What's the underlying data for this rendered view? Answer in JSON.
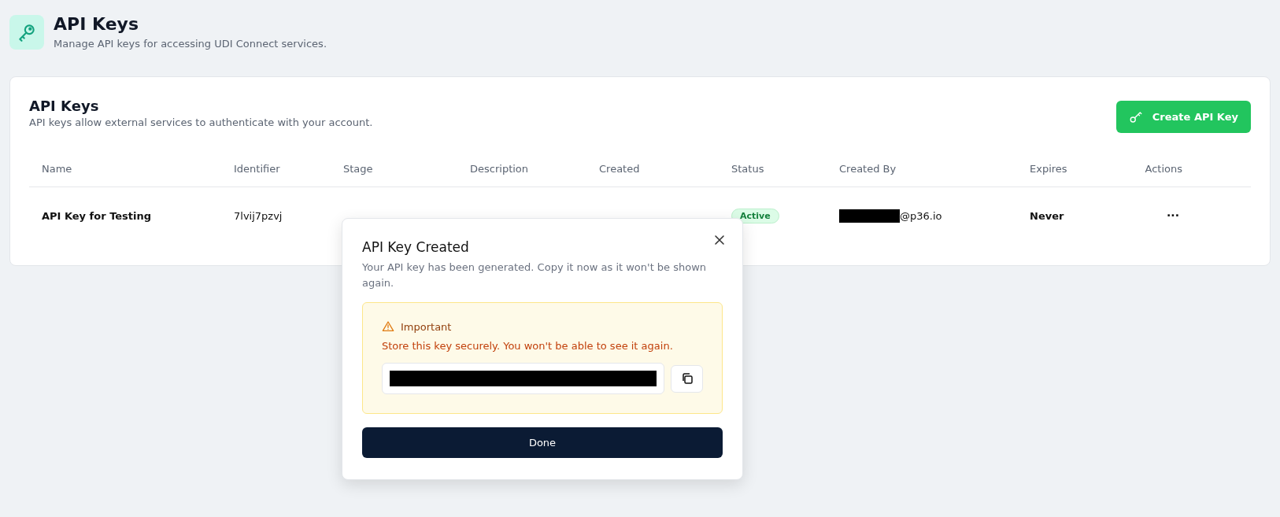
{
  "page": {
    "title": "API Keys",
    "subtitle": "Manage API keys for accessing UDI Connect services."
  },
  "card": {
    "title": "API Keys",
    "description": "API keys allow external services to authenticate with your account.",
    "create_button": "Create API Key"
  },
  "table": {
    "columns": [
      "Name",
      "Identifier",
      "Stage",
      "Description",
      "Created",
      "Status",
      "Created By",
      "Expires",
      "Actions"
    ],
    "rows": [
      {
        "name": "API Key for Testing",
        "identifier": "7lvij7pzvj",
        "status": "Active",
        "created_by": "@p36.io",
        "created_by_redacted": true,
        "expires": "Never",
        "actions": "···"
      }
    ]
  },
  "dialog": {
    "title": "API Key Created",
    "description": "Your API key has been generated. Copy it now as it won't be shown again.",
    "alert": {
      "title": "Important",
      "message": "Store this key securely. You won't be able to see it again."
    },
    "key_redacted": true,
    "button": "Done"
  }
}
